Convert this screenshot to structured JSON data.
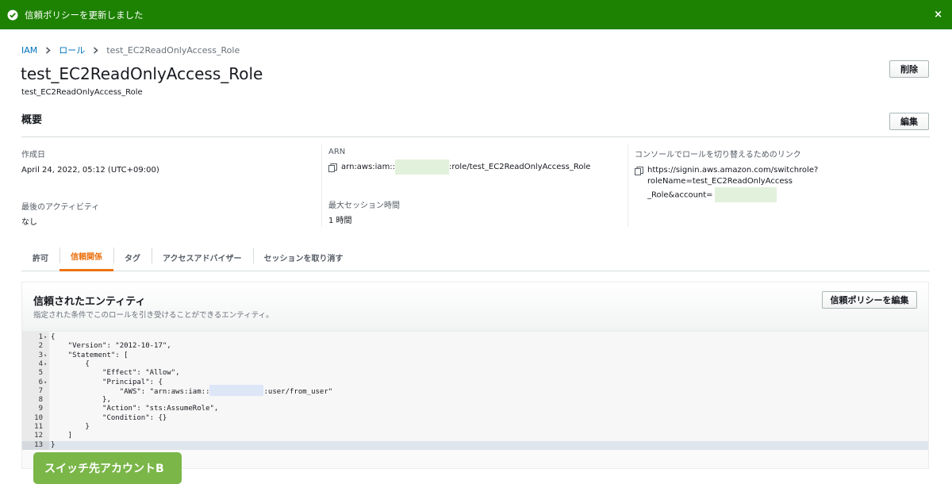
{
  "flash": {
    "message": "信頼ポリシーを更新しました",
    "close": "×"
  },
  "breadcrumb": {
    "root": "IAM",
    "parent": "ロール",
    "current": "test_EC2ReadOnlyAccess_Role"
  },
  "header": {
    "title": "test_EC2ReadOnlyAccess_Role",
    "subtitle": "test_EC2ReadOnlyAccess_Role",
    "delete_label": "削除"
  },
  "summary": {
    "heading": "概要",
    "edit_label": "編集",
    "created_label": "作成日",
    "created_value": "April 24, 2022, 05:12 (UTC+09:00)",
    "last_activity_label": "最後のアクティビティ",
    "last_activity_value": "なし",
    "arn_label": "ARN",
    "arn_prefix": "arn:aws:iam::",
    "arn_suffix": ":role/test_EC2ReadOnlyAccess_Role",
    "max_session_label": "最大セッション時間",
    "max_session_value": "1 時間",
    "switch_link_label": "コンソールでロールを切り替えるためのリンク",
    "switch_link_line1": "https://signin.aws.amazon.com/switchrole?roleName=test_EC2ReadOnlyAccess",
    "switch_link_line2": "_Role&account="
  },
  "tabs": [
    {
      "label": "許可"
    },
    {
      "label": "信頼関係"
    },
    {
      "label": "タグ"
    },
    {
      "label": "アクセスアドバイザー"
    },
    {
      "label": "セッションを取り消す"
    }
  ],
  "active_tab": "信頼関係",
  "trust_panel": {
    "title": "信頼されたエンティティ",
    "description": "指定された条件でこのロールを引き受けることができるエンティティ。",
    "edit_button": "信頼ポリシーを編集"
  },
  "policy_code": {
    "lines": [
      {
        "n": "1",
        "fold": "▾",
        "text": "{"
      },
      {
        "n": "2",
        "fold": "",
        "text": "    \"Version\": \"2012-10-17\","
      },
      {
        "n": "3",
        "fold": "▾",
        "text": "    \"Statement\": ["
      },
      {
        "n": "4",
        "fold": "▾",
        "text": "        {"
      },
      {
        "n": "5",
        "fold": "",
        "text": "            \"Effect\": \"Allow\","
      },
      {
        "n": "6",
        "fold": "▾",
        "text": "            \"Principal\": {"
      },
      {
        "n": "7",
        "fold": "",
        "text": "                \"AWS\": \"arn:aws:iam::"
      },
      {
        "n": "8",
        "fold": "",
        "text": "            },"
      },
      {
        "n": "9",
        "fold": "",
        "text": "            \"Action\": \"sts:AssumeRole\","
      },
      {
        "n": "10",
        "fold": "",
        "text": "            \"Condition\": {}"
      },
      {
        "n": "11",
        "fold": "",
        "text": "        }"
      },
      {
        "n": "12",
        "fold": "",
        "text": "    ]"
      },
      {
        "n": "13",
        "fold": "",
        "text": "}"
      }
    ],
    "line7_suffix": ":user/from_user\""
  },
  "badge": {
    "label": "スイッチ先アカウントB"
  },
  "colors": {
    "flash_bg": "#1d8102",
    "link": "#0073bb",
    "active_tab": "#ec7211",
    "badge_bg": "#7ab648"
  }
}
